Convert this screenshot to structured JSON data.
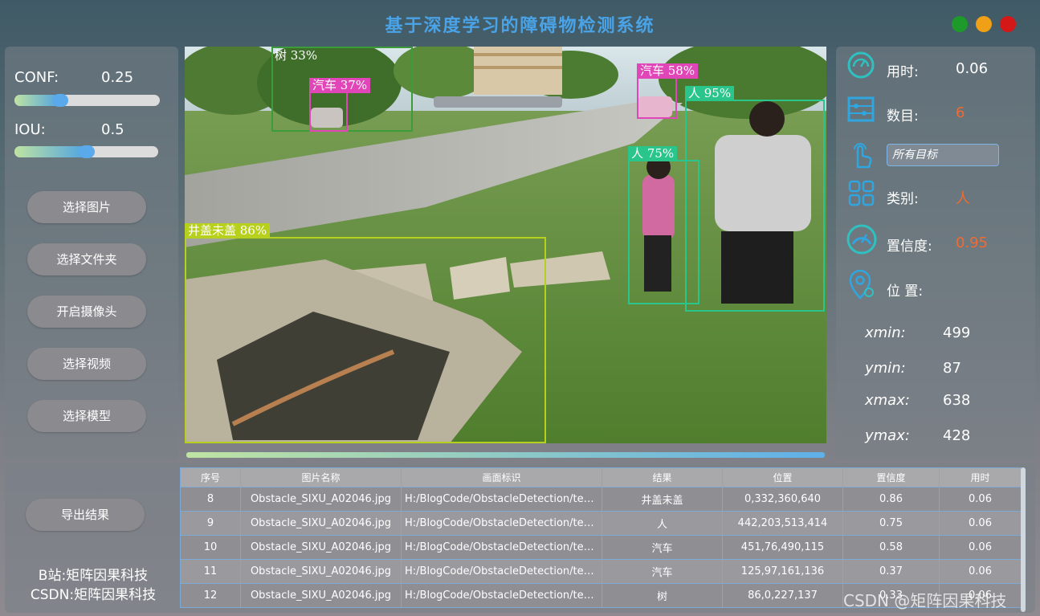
{
  "window": {
    "title": "基于深度学习的障碍物检测系统",
    "controls": [
      "green",
      "yellow",
      "red"
    ],
    "colors": {
      "title": "#4aa3e6",
      "accent": "#5aa9ea"
    }
  },
  "params": {
    "conf_label": "CONF:",
    "conf_value": "0.25",
    "conf_level": 0.25,
    "iou_label": "IOU:",
    "iou_value": "0.5",
    "iou_level": 0.5
  },
  "buttons": {
    "select_image": "选择图片",
    "select_folder": "选择文件夹",
    "open_camera": "开启摄像头",
    "select_video": "选择视频",
    "select_model": "选择模型",
    "export": "导出结果"
  },
  "detections": [
    {
      "label": "树 33%",
      "color": "#3d9c3a"
    },
    {
      "label": "汽车 37%",
      "color": "#e046b8"
    },
    {
      "label": "汽车 58%",
      "color": "#e046b8"
    },
    {
      "label": "人 95%",
      "color": "#29c58a"
    },
    {
      "label": "人 75%",
      "color": "#29c58a"
    },
    {
      "label": "井盖未盖 86%",
      "color": "#b7cf1d"
    }
  ],
  "info": {
    "time_label": "用时:",
    "time_value": "0.06",
    "count_label": "数目:",
    "count_value": "6",
    "target_select": "所有目标",
    "class_label": "类别:",
    "class_value": "人",
    "conf_label": "置信度:",
    "conf_value": "0.95",
    "position_label": "位 置:",
    "value_color": "#f26a2f",
    "icons": [
      "gauge-icon",
      "abacus-icon",
      "tap-icon",
      "grid-icon",
      "speedometer-icon",
      "location-icon"
    ]
  },
  "coords": {
    "xmin_label": "xmin:",
    "xmin": "499",
    "ymin_label": "ymin:",
    "ymin": "87",
    "xmax_label": "xmax:",
    "xmax": "638",
    "ymax_label": "ymax:",
    "ymax": "428"
  },
  "table": {
    "headers": [
      "序号",
      "图片名称",
      "画面标识",
      "结果",
      "位置",
      "置信度",
      "用时"
    ],
    "rows": [
      [
        "8",
        "Obstacle_SIXU_A02046.jpg",
        "H:/BlogCode/ObstacleDetection/test...",
        "井盖未盖",
        "0,332,360,640",
        "0.86",
        "0.06"
      ],
      [
        "9",
        "Obstacle_SIXU_A02046.jpg",
        "H:/BlogCode/ObstacleDetection/test...",
        "人",
        "442,203,513,414",
        "0.75",
        "0.06"
      ],
      [
        "10",
        "Obstacle_SIXU_A02046.jpg",
        "H:/BlogCode/ObstacleDetection/test...",
        "汽车",
        "451,76,490,115",
        "0.58",
        "0.06"
      ],
      [
        "11",
        "Obstacle_SIXU_A02046.jpg",
        "H:/BlogCode/ObstacleDetection/test...",
        "汽车",
        "125,97,161,136",
        "0.37",
        "0.06"
      ],
      [
        "12",
        "Obstacle_SIXU_A02046.jpg",
        "H:/BlogCode/ObstacleDetection/test...",
        "树",
        "86,0,227,137",
        "0.33",
        "0.06"
      ]
    ]
  },
  "credits": {
    "bilibili": "B站:矩阵因果科技",
    "csdn": "CSDN:矩阵因果科技"
  },
  "watermark": "CSDN @矩阵因果科技"
}
